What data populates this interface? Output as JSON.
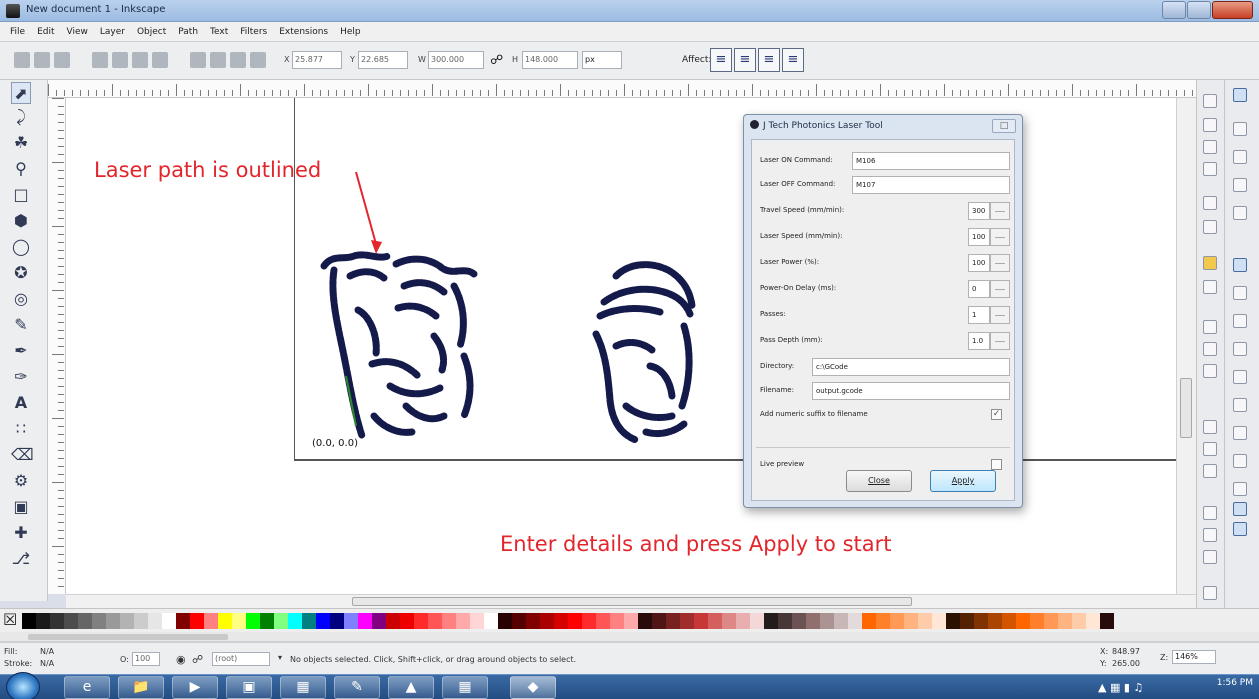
{
  "window": {
    "title": "New document 1 - Inkscape"
  },
  "menu": [
    "File",
    "Edit",
    "View",
    "Layer",
    "Object",
    "Path",
    "Text",
    "Filters",
    "Extensions",
    "Help"
  ],
  "toolbar": {
    "x_label": "X",
    "x_value": "25.877",
    "y_label": "Y",
    "y_value": "22.685",
    "w_label": "W",
    "w_value": "300.000",
    "h_label": "H",
    "h_value": "148.000",
    "unit": "px",
    "affect_label": "Affect:"
  },
  "canvas": {
    "origin_label": "(0.0, 0.0)",
    "annotation_top": "Laser path is outlined",
    "annotation_bottom": "Enter details and press Apply to start"
  },
  "dialog": {
    "title": "J Tech Photonics Laser Tool",
    "fields": [
      {
        "label": "Laser ON Command:",
        "value": "M106",
        "kind": "text"
      },
      {
        "label": "Laser OFF Command:",
        "value": "M107",
        "kind": "text"
      },
      {
        "label": "Travel Speed (mm/min):",
        "value": "300",
        "kind": "spin"
      },
      {
        "label": "Laser Speed (mm/min):",
        "value": "100",
        "kind": "spin"
      },
      {
        "label": "Laser Power (%):",
        "value": "100",
        "kind": "spin"
      },
      {
        "label": "Power-On Delay (ms):",
        "value": "0",
        "kind": "spin"
      },
      {
        "label": "Passes:",
        "value": "1",
        "kind": "spin"
      },
      {
        "label": "Pass Depth (mm):",
        "value": "1.0",
        "kind": "spin"
      },
      {
        "label": "Directory:",
        "value": "c:\\GCode",
        "kind": "text"
      },
      {
        "label": "Filename:",
        "value": "output.gcode",
        "kind": "text"
      }
    ],
    "suffix_label": "Add numeric suffix to filename",
    "suffix_checked": true,
    "live_preview_label": "Live preview",
    "live_preview_checked": false,
    "close_label": "Close",
    "apply_label": "Apply"
  },
  "status": {
    "fill_label": "Fill:",
    "fill_value": "N/A",
    "stroke_label": "Stroke:",
    "stroke_value": "N/A",
    "opacity_value": "100",
    "layer": "(root)",
    "message": "No objects selected. Click, Shift+click, or drag around objects to select.",
    "cursor_x_label": "X:",
    "cursor_x": "848.97",
    "cursor_y_label": "Y:",
    "cursor_y": "265.00",
    "zoom_label": "Z:",
    "zoom": "146%"
  },
  "taskbar": {
    "time": "1:56 PM"
  },
  "colors": {
    "annotation": "#e3252c",
    "laser_path": "#141a4a",
    "titlebar": "#9dbbe2",
    "taskbar": "#234d82"
  },
  "icons": [
    "selector-icon",
    "node-icon",
    "tweak-icon",
    "zoom-icon",
    "rect-icon",
    "3dbox-icon",
    "ellipse-icon",
    "star-icon",
    "spiral-icon",
    "pencil-icon",
    "pen-icon",
    "calligraphy-icon",
    "text-icon",
    "spray-icon",
    "eraser-icon",
    "bucket-icon",
    "gradient-icon",
    "dropper-icon",
    "connector-icon"
  ]
}
